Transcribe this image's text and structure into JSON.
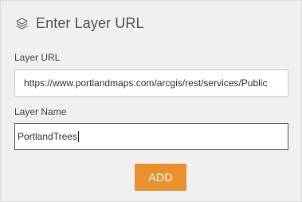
{
  "header": {
    "title": "Enter Layer URL",
    "icon": "layers-icon"
  },
  "form": {
    "url_label": "Layer URL",
    "url_value": "https://www.portlandmaps.com/arcgis/rest/services/Public",
    "name_label": "Layer Name",
    "name_value": "PortlandTrees"
  },
  "actions": {
    "add_label": "ADD"
  },
  "colors": {
    "accent": "#e8922e",
    "background": "#f0f0f0"
  }
}
